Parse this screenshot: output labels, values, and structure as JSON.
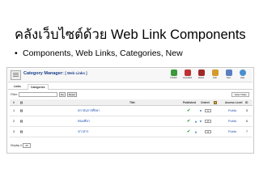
{
  "slide": {
    "title": "คลังเว็บไซต์ด้วย Web Link Components",
    "bullet": "Components, Web Links, Categories, New"
  },
  "window": {
    "manager_title": "Category Manager:",
    "manager_section": "[ Web Links ]",
    "toolbar": [
      {
        "label": "Publish",
        "icon": "publish-icon",
        "color": "#3a9a3a"
      },
      {
        "label": "Unpublish",
        "icon": "unpublish-icon",
        "color": "#c03030"
      },
      {
        "label": "Delete",
        "icon": "delete-icon",
        "color": "#a02828"
      },
      {
        "label": "Edit",
        "icon": "edit-icon",
        "color": "#d49a2a"
      },
      {
        "label": "New",
        "icon": "new-icon",
        "color": "#5a7fc0"
      },
      {
        "label": "Help",
        "icon": "help-icon",
        "color": "#4a8fd0"
      }
    ],
    "tabs": [
      "Links",
      "Categories"
    ],
    "filter": {
      "label": "Filter:",
      "value": "",
      "go": "Go",
      "reset": "Reset",
      "state": "- Select State -"
    },
    "columns": {
      "num": "#",
      "title": "Title",
      "published": "Published",
      "order": "Order#",
      "access": "Access Level",
      "id": "ID"
    },
    "rows": [
      {
        "num": "1",
        "title": "สถาบันการศึกษา",
        "published": "✔",
        "order": "1",
        "access": "Public",
        "id": "5"
      },
      {
        "num": "2",
        "title": "ท่องเที่ยว",
        "published": "✔",
        "order": "2",
        "access": "Public",
        "id": "6"
      },
      {
        "num": "3",
        "title": "ข่าวสาร",
        "published": "✔",
        "order": "3",
        "access": "Public",
        "id": "7"
      }
    ],
    "footer": {
      "display_label": "Display #",
      "display_value": "20"
    }
  }
}
